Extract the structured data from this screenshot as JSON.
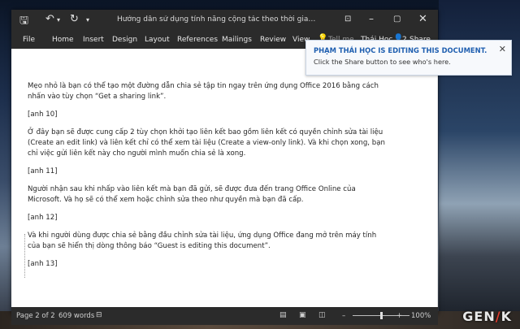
{
  "window": {
    "title": "Hướng dẫn sử dụng tính năng cộng tác theo thời gian thực trong Office..."
  },
  "ribbon": {
    "tabs": [
      "File",
      "Home",
      "Insert",
      "Design",
      "Layout",
      "References",
      "Mailings",
      "Review",
      "View"
    ],
    "tell_me": "Tell me...",
    "user": "Thái Học",
    "share_count": "2",
    "share_label": "Share"
  },
  "notice": {
    "title": "PHẠM THÁI HỌC IS EDITING THIS DOCUMENT.",
    "body": "Click the Share button to see who's here."
  },
  "document": {
    "paragraphs": [
      "Mẹo nhỏ là bạn có thể tạo một đường dẫn chia sẻ tập tin ngay trên ứng dụng Office 2016 bằng cách nhấn vào tùy chọn “Get a sharing link”.",
      "[anh 10]",
      "Ở đây bạn sẽ được cung cấp 2 tùy chọn khởi tạo liên kết bao gồm liên kết có quyền chỉnh sửa tài liệu (Create an edit link) và liên kết chỉ có thể xem tài liệu (Create a view-only link). Và khi chọn xong, bạn chỉ việc gửi liên kết này cho người mình muốn chia sẻ là xong.",
      "[anh 11]",
      "Người nhận sau khi nhấp vào liên kết mà bạn đã gửi, sẽ được đưa đến trang Office Online của Microsoft. Và họ sẽ có thể xem hoặc chỉnh sửa theo như quyền mà bạn đã cấp.",
      "[anh 12]",
      "Và khi người dùng được chia sẻ bằng đầu chỉnh sửa tài liệu, ứng dụng Office đang mở trên máy tính của bạn sẽ hiển thị dòng thông báo “Guest is editing this document”.",
      "[anh 13]"
    ]
  },
  "status": {
    "page": "Page 2 of 2",
    "words": "609 words",
    "zoom": "100%",
    "zoom_fraction": 0.5
  },
  "watermark": {
    "text_left": "GEN",
    "text_right": "K"
  }
}
